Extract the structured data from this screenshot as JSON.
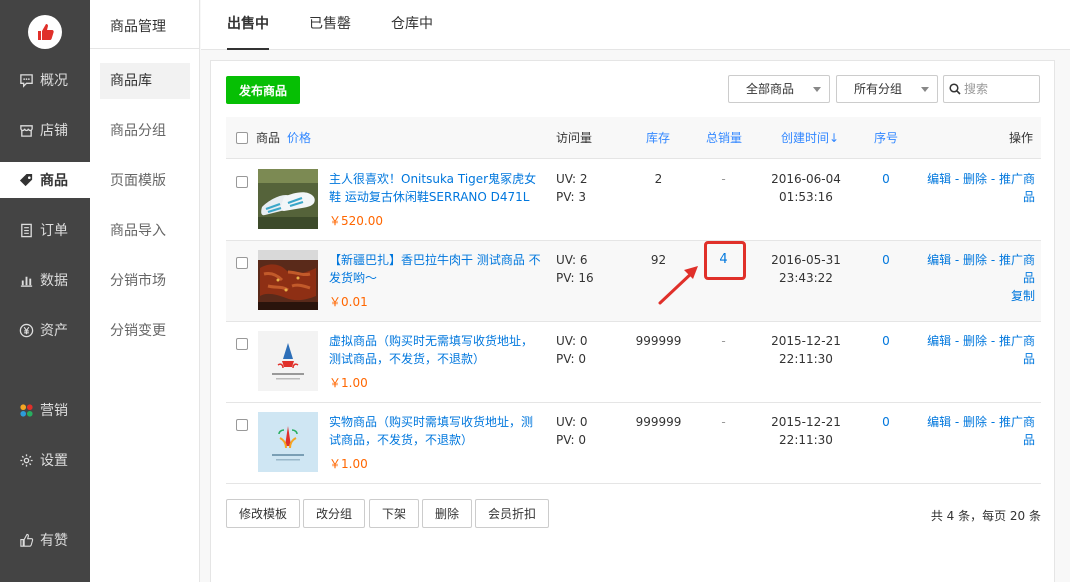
{
  "sidebar": {
    "items": [
      {
        "label": "概况",
        "icon": "chat-icon"
      },
      {
        "label": "店铺",
        "icon": "store-icon"
      },
      {
        "label": "商品",
        "icon": "tag-icon"
      },
      {
        "label": "订单",
        "icon": "list-icon"
      },
      {
        "label": "数据",
        "icon": "chart-icon"
      },
      {
        "label": "资产",
        "icon": "yen-icon"
      },
      {
        "label": "营销",
        "icon": "apps-icon"
      },
      {
        "label": "设置",
        "icon": "gear-icon"
      },
      {
        "label": "有赞",
        "icon": "thumb-icon"
      }
    ]
  },
  "subnav": {
    "title": "商品管理",
    "items": [
      "商品库",
      "商品分组",
      "页面模版",
      "商品导入",
      "分销市场",
      "分销变更"
    ]
  },
  "tabs": [
    "出售中",
    "已售罄",
    "仓库中"
  ],
  "toolbar": {
    "publish_label": "发布商品",
    "filter_all": "全部商品",
    "filter_group": "所有分组",
    "search_placeholder": "搜索"
  },
  "table": {
    "headers": {
      "product": "商品",
      "price": "价格",
      "visits": "访问量",
      "stock": "库存",
      "sales": "总销量",
      "created": "创建时间↓",
      "seq": "序号",
      "ops": "操作"
    },
    "rows": [
      {
        "title": "主人很喜欢！Onitsuka Tiger鬼冢虎女鞋 运动复古休闲鞋SERRANO D471L",
        "price": "￥520.00",
        "uv": "UV: 2",
        "pv": "PV: 3",
        "stock": "2",
        "sales": "-",
        "date": "2016-06-04",
        "time": "01:53:16",
        "seq": "0",
        "ops_line1": "编辑 - 删除 - 推广商",
        "ops_line2": "品",
        "ops_line3": ""
      },
      {
        "title": "【新疆巴扎】香巴拉牛肉干 测试商品 不发货哟～",
        "price": "￥0.01",
        "uv": "UV: 6",
        "pv": "PV: 16",
        "stock": "92",
        "sales": "4",
        "date": "2016-05-31",
        "time": "23:43:22",
        "seq": "0",
        "ops_line1": "编辑 - 删除 - 推广商",
        "ops_line2": "品",
        "ops_line3": "复制"
      },
      {
        "title": "虚拟商品（购买时无需填写收货地址，测试商品，不发货，不退款）",
        "price": "￥1.00",
        "uv": "UV: 0",
        "pv": "PV: 0",
        "stock": "999999",
        "sales": "-",
        "date": "2015-12-21",
        "time": "22:11:30",
        "seq": "0",
        "ops_line1": "编辑 - 删除 - 推广商",
        "ops_line2": "品",
        "ops_line3": ""
      },
      {
        "title": "实物商品（购买时需填写收货地址，测试商品，不发货，不退款）",
        "price": "￥1.00",
        "uv": "UV: 0",
        "pv": "PV: 0",
        "stock": "999999",
        "sales": "-",
        "date": "2015-12-21",
        "time": "22:11:30",
        "seq": "0",
        "ops_line1": "编辑 - 删除 - 推广商",
        "ops_line2": "品",
        "ops_line3": ""
      }
    ]
  },
  "bottom": {
    "buttons": [
      "修改模板",
      "改分组",
      "下架",
      "删除",
      "会员折扣"
    ],
    "pager": "共 4 条，每页 20 条"
  },
  "colors": {
    "sidebar_bg": "#444444",
    "primary_green": "#06bf04",
    "link_blue": "#0077dd",
    "price_orange": "#ff6600",
    "highlight_red": "#e0302a"
  }
}
